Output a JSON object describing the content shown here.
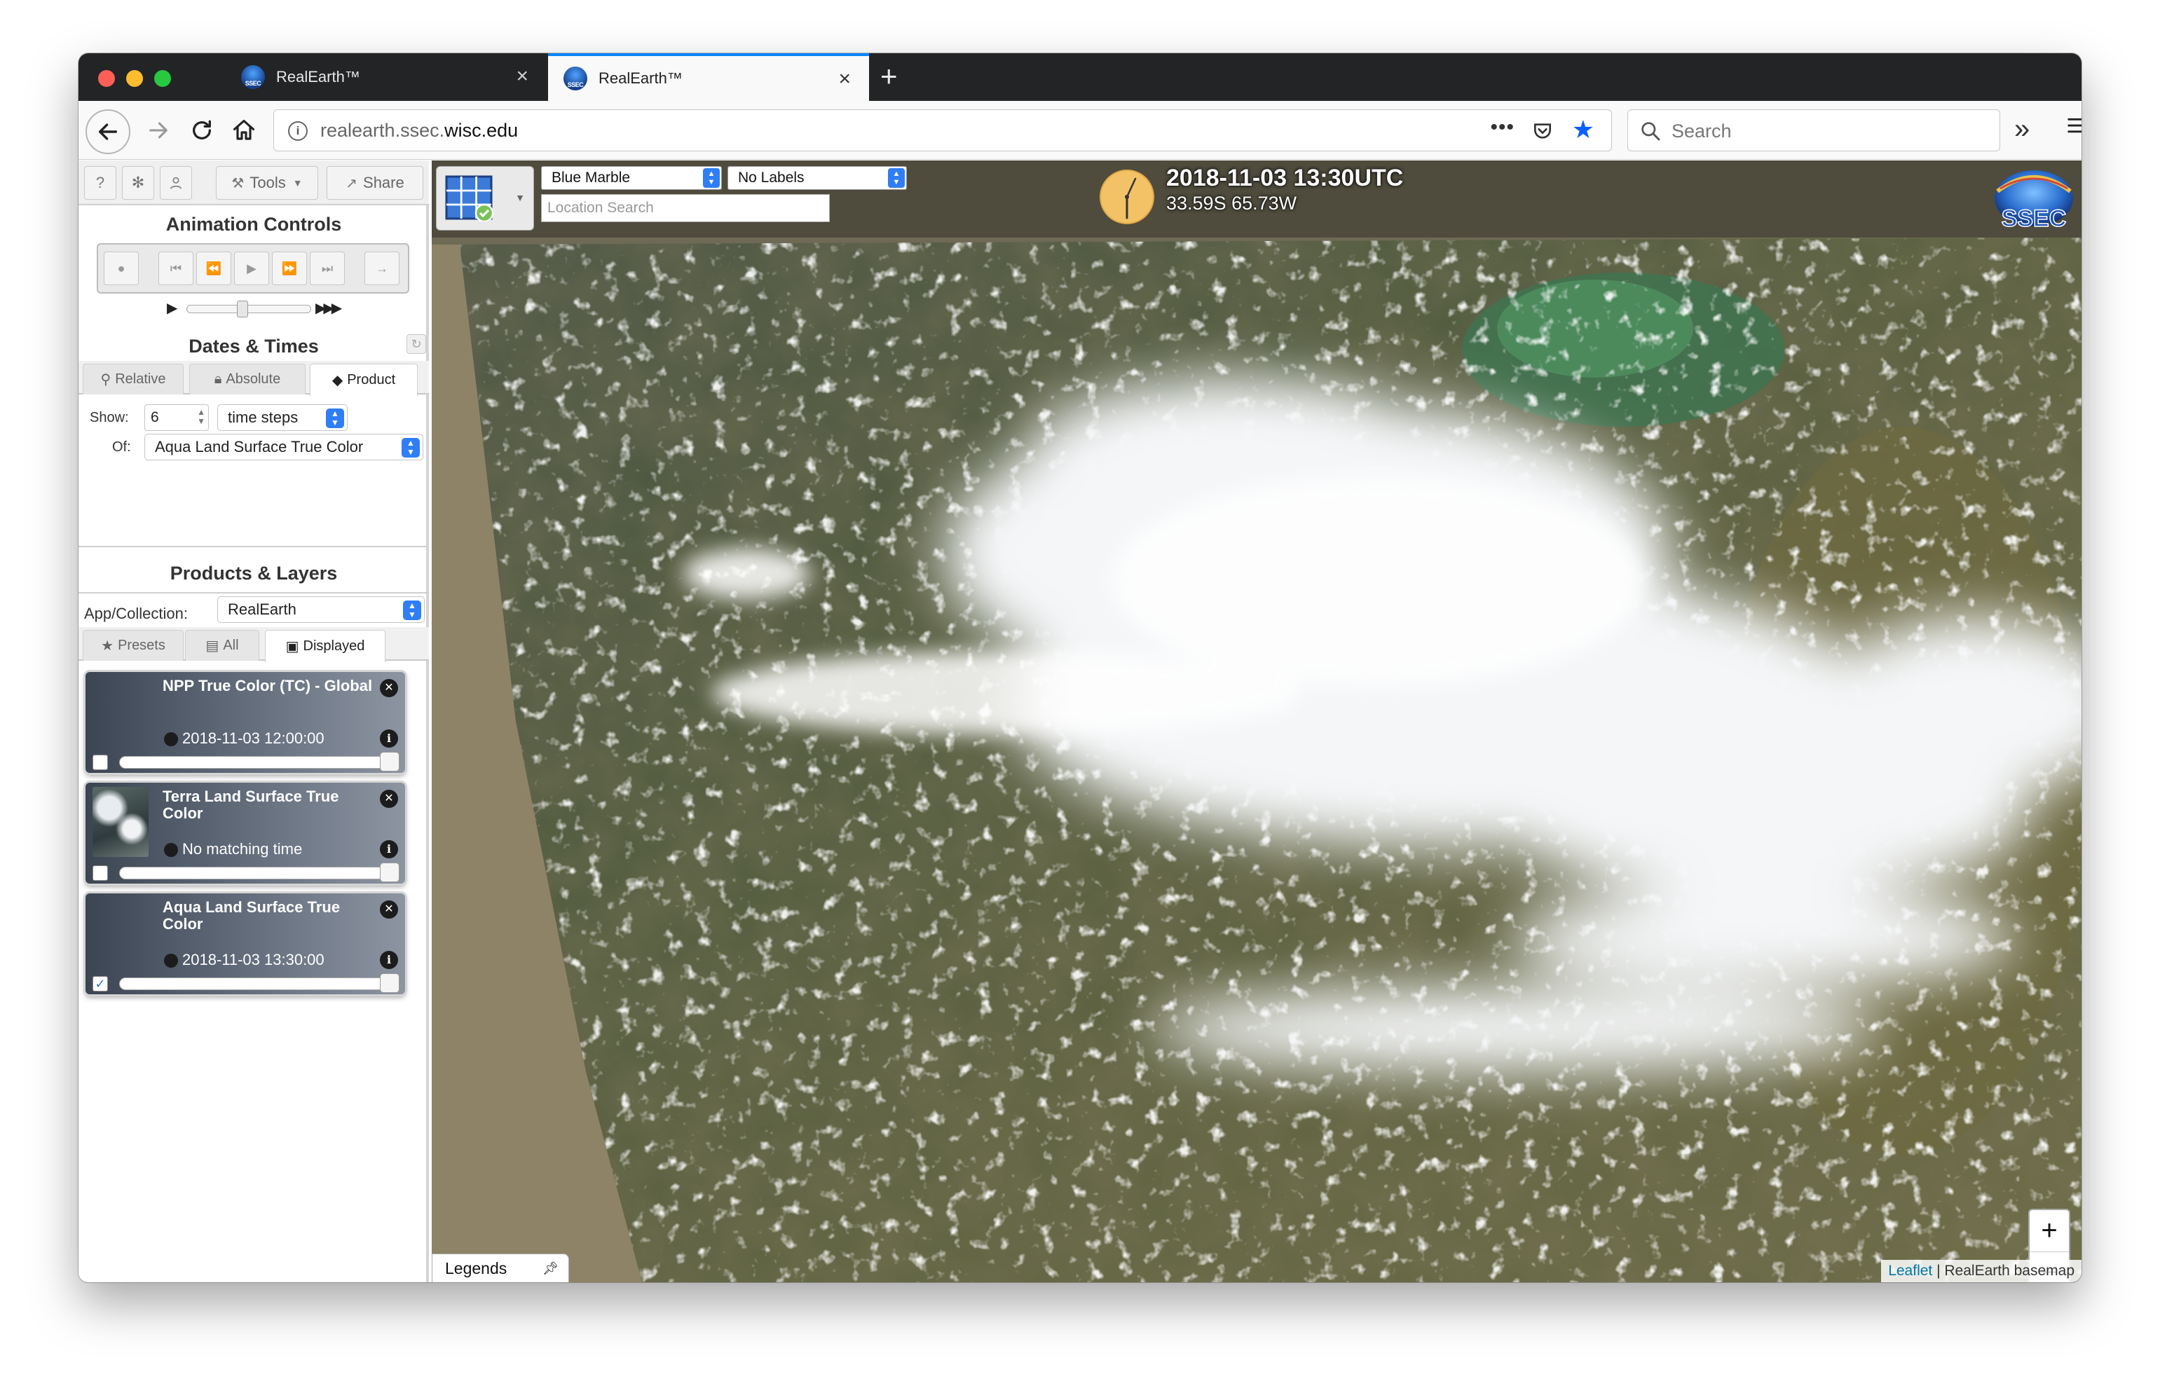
{
  "browser": {
    "tabs": [
      {
        "title": "RealEarth™",
        "active": false
      },
      {
        "title": "RealEarth™",
        "active": true
      }
    ],
    "url_domain_prefix": "realearth.ssec.",
    "url_domain_main": "wisc.edu",
    "search_placeholder": "Search",
    "accent_color": "#0a84ff"
  },
  "toolbar": {
    "help_icon": "?",
    "settings_icon": "gear-icon",
    "user_icon": "user-icon",
    "tools_label": "Tools",
    "share_label": "Share"
  },
  "animation": {
    "heading": "Animation Controls"
  },
  "dates": {
    "heading": "Dates & Times",
    "tabs": [
      "Relative",
      "Absolute",
      "Product"
    ],
    "active_tab": "Product",
    "show_label": "Show:",
    "show_value": "6",
    "unit_value": "time steps",
    "of_label": "Of:",
    "of_value": "Aqua Land Surface True Color"
  },
  "products": {
    "heading": "Products & Layers",
    "collection_label": "App/Collection:",
    "collection_value": "RealEarth",
    "tabs": [
      "Presets",
      "All",
      "Displayed"
    ],
    "active_tab": "Displayed",
    "layers": [
      {
        "title": "NPP True Color (TC) - Global",
        "time": "2018-11-03 12:00:00",
        "checked": false,
        "opacity": 1.0
      },
      {
        "title": "Terra Land Surface True Color",
        "time": "No matching time",
        "checked": false,
        "opacity": 1.0
      },
      {
        "title": "Aqua Land Surface True Color",
        "time": "2018-11-03 13:30:00",
        "checked": true,
        "opacity": 1.0
      }
    ]
  },
  "map": {
    "basemap": "Blue Marble",
    "labels": "No Labels",
    "location_placeholder": "Location Search",
    "datetime": "2018-11-03 13:30UTC",
    "coords": "33.59S 65.73W",
    "logo_text": "SSEC",
    "zoom_in": "+",
    "zoom_out": "−",
    "legends_label": "Legends",
    "attribution_link": "Leaflet",
    "attribution_text": " | RealEarth basemap"
  }
}
